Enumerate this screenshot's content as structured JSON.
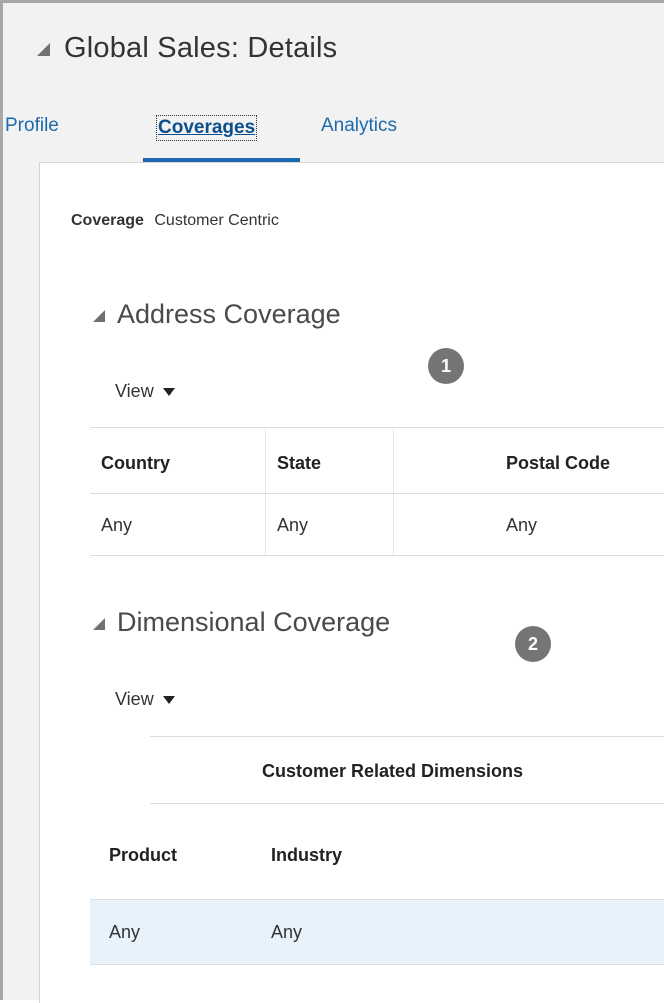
{
  "header": {
    "title": "Global Sales: Details"
  },
  "tabs": [
    {
      "label": "Profile"
    },
    {
      "label": "Coverages",
      "selected": true
    },
    {
      "label": "Analytics"
    }
  ],
  "coverage": {
    "label": "Coverage",
    "value": "Customer Centric"
  },
  "address_coverage": {
    "title": "Address Coverage",
    "badge": "1",
    "view_label": "View",
    "columns": [
      "Country",
      "State",
      "Postal Code"
    ],
    "rows": [
      [
        "Any",
        "Any",
        "Any"
      ]
    ]
  },
  "dimensional_coverage": {
    "title": "Dimensional Coverage",
    "badge": "2",
    "view_label": "View",
    "group_header": "Customer Related Dimensions",
    "columns": [
      "Product",
      "Industry"
    ],
    "rows": [
      [
        "Any",
        "Any"
      ]
    ]
  },
  "colors": {
    "link": "#1c6aae",
    "badge": "#757575",
    "selected_row": "#e8f2fb",
    "page_background": "#f2f2f2"
  },
  "icons": {
    "collapse": "triangle-collapse-icon",
    "dropdown": "caret-down-icon"
  }
}
